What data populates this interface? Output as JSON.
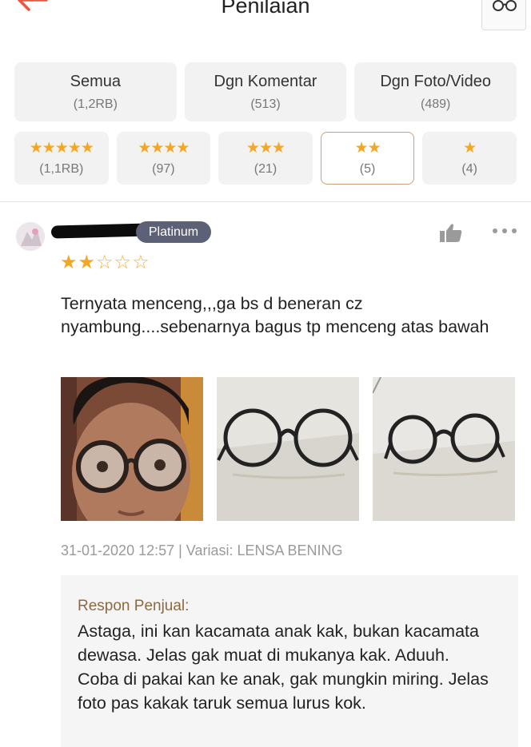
{
  "header": {
    "title": "Penilaian"
  },
  "filters": [
    {
      "label": "Semua",
      "count": "(1,2RB)"
    },
    {
      "label": "Dgn Komentar",
      "count": "(513)"
    },
    {
      "label": "Dgn Foto/Video",
      "count": "(489)"
    }
  ],
  "star_filters": [
    {
      "stars": "★★★★★",
      "count": "(1,1RB)"
    },
    {
      "stars": "★★★★",
      "count": "(97)"
    },
    {
      "stars": "★★★",
      "count": "(21)"
    },
    {
      "stars": "★★",
      "count": "(5)",
      "selected": true
    },
    {
      "stars": "★",
      "count": "(4)"
    }
  ],
  "review": {
    "badge": "Platinum",
    "rating": 2,
    "rating_max": 5,
    "stars_on": "★★",
    "stars_off": "☆☆☆",
    "text": "Ternyata menceng,,,ga bs d beneran cz nyambung....sebenarnya bagus tp menceng atas bawah",
    "meta": "31-01-2020 12:57 | Variasi: LENSA BENING",
    "photos": [
      "selfie-wearing-glasses",
      "round-glasses-front",
      "round-glasses-angle"
    ]
  },
  "response": {
    "title": "Respon Penjual:",
    "text": "Astaga, ini kan kacamata anak kak, bukan kacamata dewasa. Jelas gak muat di mukanya kak. Aduuh. Coba di pakai kan ke anak, gak mungkin miring. Jelas foto pas kakak taruk semua lurus kok."
  },
  "colors": {
    "accent": "#e8563f",
    "star": "#f5a623",
    "badge": "#5d6178",
    "response_title": "#8b6a3e",
    "selected_border": "#c9a27a"
  },
  "icons": [
    "back-arrow-icon",
    "like-icon",
    "more-options-icon"
  ]
}
